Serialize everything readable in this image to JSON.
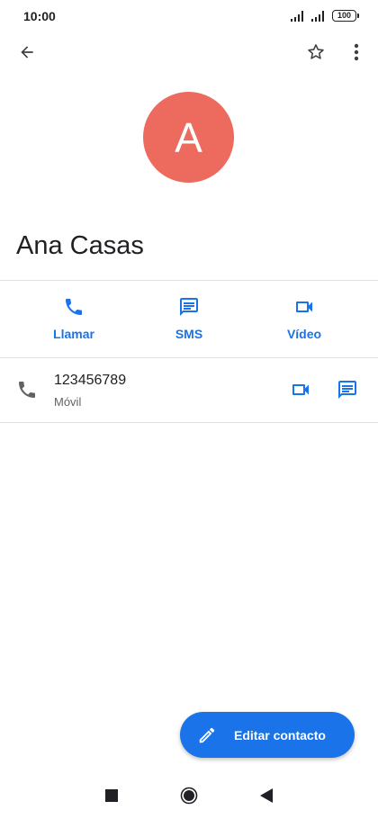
{
  "status": {
    "time": "10:00",
    "battery": "100"
  },
  "header": {
    "back_icon": "arrow-back-icon",
    "star_icon": "star-outline-icon",
    "more_icon": "more-vert-icon"
  },
  "contact": {
    "initial": "A",
    "name": "Ana Casas",
    "avatar_color": "#ec6a5e"
  },
  "actions": [
    {
      "icon": "phone-icon",
      "label": "Llamar"
    },
    {
      "icon": "message-icon",
      "label": "SMS"
    },
    {
      "icon": "videocam-icon",
      "label": "Vídeo"
    }
  ],
  "phone": {
    "number": "123456789",
    "type": "Móvil"
  },
  "fab": {
    "icon": "edit-pencil-icon",
    "label": "Editar contacto"
  },
  "colors": {
    "accent": "#1a73e8",
    "text": "#202124",
    "secondary_text": "#5f6368"
  }
}
